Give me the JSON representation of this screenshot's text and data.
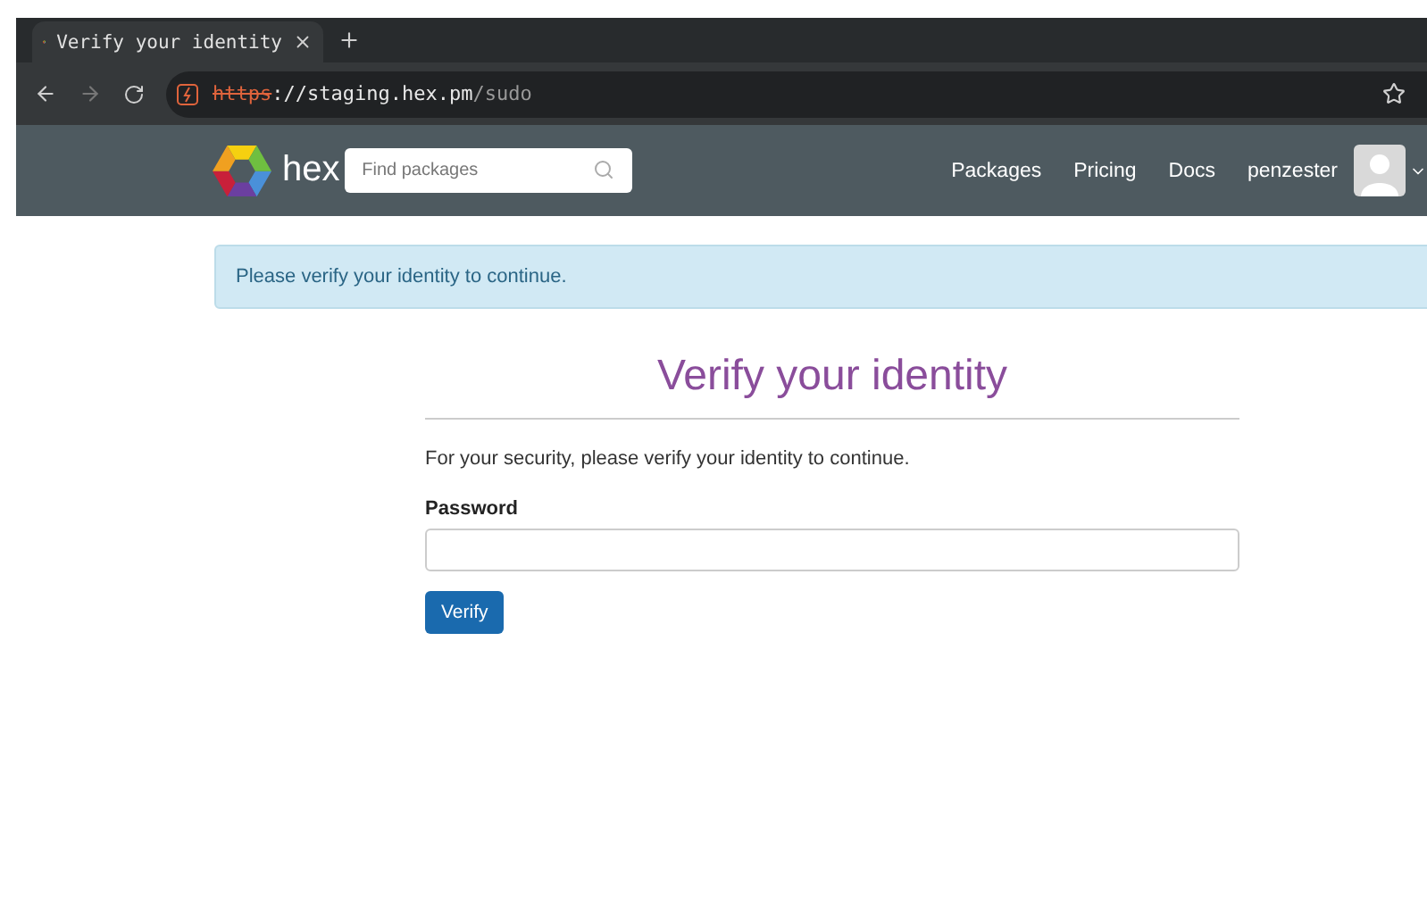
{
  "browser": {
    "tab": {
      "title": "Verify your identity",
      "selected": true
    },
    "url": {
      "scheme": "https",
      "host": "://staging.hex.pm",
      "path": "/sudo"
    }
  },
  "navbar": {
    "logo_text": "hex",
    "search": {
      "placeholder": "Find packages"
    },
    "links": [
      "Packages",
      "Pricing",
      "Docs"
    ],
    "user": "penzester"
  },
  "alert": {
    "text": "Please verify your identity to continue."
  },
  "form": {
    "title": "Verify your identity",
    "intro": "For your security, please verify your identity to continue.",
    "password_label": "Password",
    "submit": "Verify"
  }
}
